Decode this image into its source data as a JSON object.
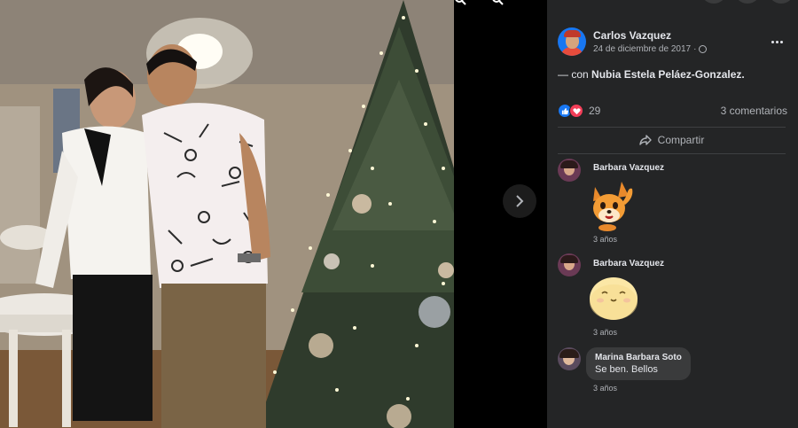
{
  "post": {
    "author": "Carlos Vazquez",
    "date": "24 de diciembre de 2017",
    "date_separator": "·",
    "tag_prefix": "— con",
    "tagged_person": "Nubia Estela Peláez-Gonzalez.",
    "reaction_count": "29",
    "comments_count": "3 comentarios",
    "share_label": "Compartir"
  },
  "comments": [
    {
      "name": "Barbara Vazquez",
      "time": "3 años",
      "content": "sticker-fox-waving"
    },
    {
      "name": "Barbara Vazquez",
      "time": "3 años",
      "content": "sticker-smiling-face"
    },
    {
      "name": "Marina Barbara Soto",
      "text": "Se ben. Bellos",
      "time": "3 años"
    }
  ],
  "colors": {
    "panel_bg": "#242526",
    "like_blue": "#1877f2",
    "love_red": "#f33e58",
    "muted_text": "#b0b3b8"
  }
}
